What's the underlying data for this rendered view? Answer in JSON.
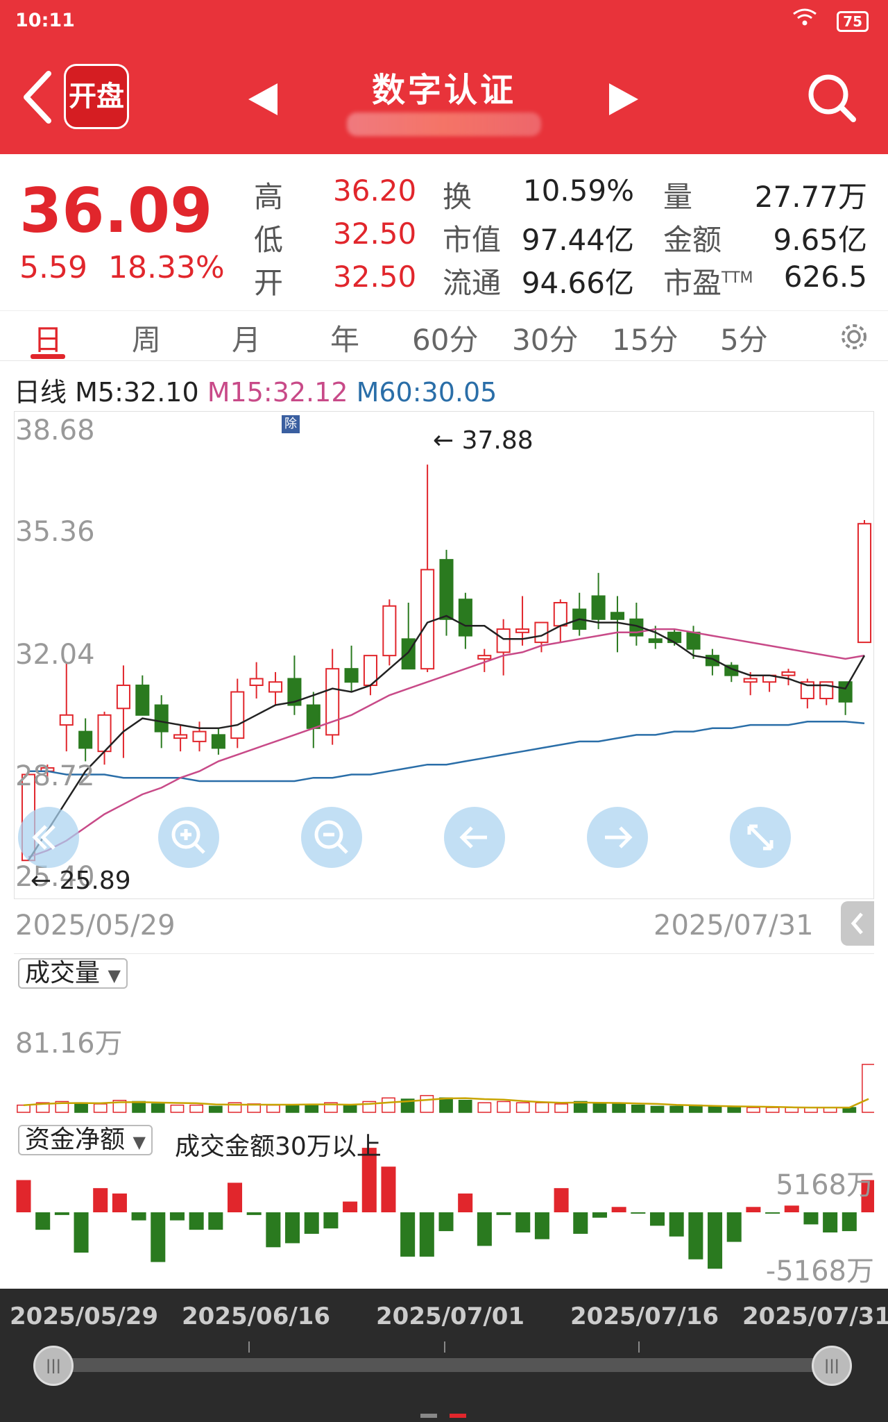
{
  "status": {
    "time": "10:11",
    "battery": "75"
  },
  "header": {
    "logo": "开盘",
    "title": "数字认证"
  },
  "quote": {
    "price": "36.09",
    "change": "5.59",
    "change_pct": "18.33%",
    "high_label": "高",
    "high": "36.20",
    "low_label": "低",
    "low": "32.50",
    "open_label": "开",
    "open": "32.50",
    "turnover_label": "换",
    "turnover": "10.59%",
    "mcap_label": "市值",
    "mcap": "97.44亿",
    "float_label": "流通",
    "float_cap": "94.66亿",
    "volume_label": "量",
    "volume": "27.77万",
    "amount_label": "金额",
    "amount": "9.65亿",
    "pe_label": "市盈",
    "pe_sup": "TTM",
    "pe": "626.5"
  },
  "tabs": [
    "日",
    "周",
    "月",
    "年",
    "60分",
    "30分",
    "15分",
    "5分"
  ],
  "ma": {
    "label": "日线",
    "m5": "M5:32.10",
    "m15": "M15:32.12",
    "m60": "M60:30.05"
  },
  "chart": {
    "y_labels": [
      "38.68",
      "35.36",
      "32.04",
      "28.72",
      "25.40"
    ],
    "high_annot": "← 37.88",
    "low_annot": "← 25.89",
    "ex_badge": "除",
    "date_start": "2025/05/29",
    "date_end": "2025/07/31"
  },
  "volume": {
    "label": "成交量",
    "max": "81.16万"
  },
  "flow": {
    "label": "资金净额",
    "note": "成交金额30万以上",
    "max": "5168万",
    "min": "-5168万"
  },
  "scrubber": {
    "dates": [
      "2025/05/29",
      "2025/06/16",
      "2025/07/01",
      "2025/07/16",
      "2025/07/31"
    ]
  },
  "chart_data": {
    "type": "candlestick",
    "ylim": [
      25.4,
      38.68
    ],
    "candles": [
      {
        "o": 25.9,
        "h": 28.6,
        "l": 25.89,
        "c": 28.5
      },
      {
        "o": 28.6,
        "h": 28.8,
        "l": 28.3,
        "c": 28.7
      },
      {
        "o": 30.0,
        "h": 31.9,
        "l": 29.2,
        "c": 30.3
      },
      {
        "o": 29.8,
        "h": 30.2,
        "l": 28.9,
        "c": 29.3
      },
      {
        "o": 29.2,
        "h": 30.4,
        "l": 28.8,
        "c": 30.3
      },
      {
        "o": 30.5,
        "h": 31.8,
        "l": 29.0,
        "c": 31.2
      },
      {
        "o": 31.2,
        "h": 31.5,
        "l": 30.4,
        "c": 30.3
      },
      {
        "o": 30.6,
        "h": 30.9,
        "l": 29.3,
        "c": 29.8
      },
      {
        "o": 29.6,
        "h": 30.0,
        "l": 29.2,
        "c": 29.7
      },
      {
        "o": 29.5,
        "h": 30.1,
        "l": 29.2,
        "c": 29.8
      },
      {
        "o": 29.7,
        "h": 29.9,
        "l": 29.1,
        "c": 29.3
      },
      {
        "o": 29.6,
        "h": 31.4,
        "l": 29.3,
        "c": 31.0
      },
      {
        "o": 31.2,
        "h": 31.9,
        "l": 30.8,
        "c": 31.4
      },
      {
        "o": 31.0,
        "h": 31.6,
        "l": 30.6,
        "c": 31.3
      },
      {
        "o": 31.4,
        "h": 32.1,
        "l": 30.3,
        "c": 30.6
      },
      {
        "o": 30.6,
        "h": 31.0,
        "l": 29.3,
        "c": 29.9
      },
      {
        "o": 29.7,
        "h": 32.3,
        "l": 29.4,
        "c": 31.7
      },
      {
        "o": 31.7,
        "h": 32.4,
        "l": 31.0,
        "c": 31.3
      },
      {
        "o": 31.2,
        "h": 32.1,
        "l": 30.9,
        "c": 32.1
      },
      {
        "o": 32.1,
        "h": 33.8,
        "l": 31.8,
        "c": 33.6
      },
      {
        "o": 32.6,
        "h": 33.7,
        "l": 31.7,
        "c": 31.7
      },
      {
        "o": 31.7,
        "h": 37.88,
        "l": 31.6,
        "c": 34.7
      },
      {
        "o": 35.0,
        "h": 35.3,
        "l": 32.7,
        "c": 33.2
      },
      {
        "o": 33.8,
        "h": 34.0,
        "l": 32.3,
        "c": 32.7
      },
      {
        "o": 32.0,
        "h": 32.3,
        "l": 31.6,
        "c": 32.1
      },
      {
        "o": 32.2,
        "h": 33.2,
        "l": 31.5,
        "c": 32.9
      },
      {
        "o": 32.8,
        "h": 33.9,
        "l": 32.4,
        "c": 32.9
      },
      {
        "o": 32.5,
        "h": 33.0,
        "l": 32.2,
        "c": 33.1
      },
      {
        "o": 33.0,
        "h": 33.8,
        "l": 32.5,
        "c": 33.7
      },
      {
        "o": 33.5,
        "h": 34.0,
        "l": 32.7,
        "c": 32.9
      },
      {
        "o": 33.9,
        "h": 34.6,
        "l": 32.9,
        "c": 33.2
      },
      {
        "o": 33.4,
        "h": 33.9,
        "l": 32.2,
        "c": 33.2
      },
      {
        "o": 33.2,
        "h": 33.7,
        "l": 32.4,
        "c": 32.7
      },
      {
        "o": 32.6,
        "h": 33.0,
        "l": 32.3,
        "c": 32.5
      },
      {
        "o": 32.8,
        "h": 32.9,
        "l": 32.4,
        "c": 32.5
      },
      {
        "o": 32.8,
        "h": 33.0,
        "l": 32.0,
        "c": 32.3
      },
      {
        "o": 32.1,
        "h": 32.3,
        "l": 31.5,
        "c": 31.8
      },
      {
        "o": 31.8,
        "h": 31.9,
        "l": 31.3,
        "c": 31.5
      },
      {
        "o": 31.3,
        "h": 31.6,
        "l": 30.9,
        "c": 31.4
      },
      {
        "o": 31.3,
        "h": 31.5,
        "l": 31.0,
        "c": 31.5
      },
      {
        "o": 31.5,
        "h": 31.7,
        "l": 31.2,
        "c": 31.6
      },
      {
        "o": 30.8,
        "h": 31.4,
        "l": 30.5,
        "c": 31.3
      },
      {
        "o": 30.8,
        "h": 31.3,
        "l": 30.6,
        "c": 31.3
      },
      {
        "o": 31.3,
        "h": 31.3,
        "l": 30.3,
        "c": 30.7
      },
      {
        "o": 32.5,
        "h": 36.2,
        "l": 32.5,
        "c": 36.09
      }
    ],
    "ma5": [
      25.9,
      26.8,
      27.7,
      28.6,
      29.2,
      29.8,
      30.2,
      30.1,
      30.0,
      29.9,
      29.9,
      30.0,
      30.3,
      30.6,
      30.7,
      30.9,
      31.1,
      31.0,
      31.2,
      31.7,
      32.2,
      33.1,
      33.3,
      33.0,
      33.0,
      32.6,
      32.6,
      32.7,
      33.0,
      33.2,
      33.1,
      33.1,
      33.0,
      32.8,
      32.5,
      32.1,
      32.0,
      31.7,
      31.5,
      31.5,
      31.4,
      31.2,
      31.2,
      31.1,
      32.1
    ],
    "ma15": [
      26.0,
      26.2,
      26.5,
      26.9,
      27.3,
      27.6,
      27.9,
      28.1,
      28.4,
      28.6,
      28.9,
      29.1,
      29.3,
      29.5,
      29.7,
      29.9,
      30.1,
      30.3,
      30.6,
      30.9,
      31.1,
      31.3,
      31.5,
      31.7,
      31.9,
      32.1,
      32.2,
      32.4,
      32.5,
      32.6,
      32.7,
      32.8,
      32.8,
      32.9,
      32.9,
      32.8,
      32.7,
      32.6,
      32.5,
      32.4,
      32.3,
      32.2,
      32.1,
      32.0,
      32.1
    ],
    "ma60": [
      28.6,
      28.6,
      28.5,
      28.5,
      28.5,
      28.4,
      28.4,
      28.4,
      28.4,
      28.3,
      28.3,
      28.3,
      28.3,
      28.3,
      28.3,
      28.4,
      28.4,
      28.5,
      28.5,
      28.6,
      28.7,
      28.8,
      28.8,
      28.9,
      29.0,
      29.1,
      29.2,
      29.3,
      29.4,
      29.5,
      29.5,
      29.6,
      29.7,
      29.7,
      29.8,
      29.8,
      29.9,
      29.9,
      30.0,
      30.0,
      30.0,
      30.1,
      30.1,
      30.1,
      30.05
    ],
    "volume": [
      6,
      8,
      9,
      8,
      7,
      10,
      9,
      7,
      6,
      6,
      5,
      8,
      7,
      6,
      6,
      6,
      8,
      6,
      9,
      12,
      11,
      14,
      12,
      10,
      8,
      9,
      8,
      8,
      7,
      9,
      8,
      7,
      6,
      5,
      5,
      6,
      5,
      4,
      4,
      4,
      4,
      4,
      4,
      4,
      40
    ],
    "flow": [
      2400,
      -1300,
      -200,
      -3000,
      1800,
      1400,
      -600,
      -3700,
      -600,
      -1300,
      -1300,
      2200,
      -200,
      -2600,
      -2300,
      -1600,
      -1200,
      800,
      4800,
      3400,
      -3300,
      -3300,
      -1400,
      1400,
      -2500,
      -200,
      -1500,
      -2000,
      1800,
      -1600,
      -400,
      400,
      -100,
      -1000,
      -1800,
      -3500,
      -4200,
      -2200,
      400,
      -100,
      500,
      -900,
      -1500,
      -1400,
      2400
    ]
  }
}
